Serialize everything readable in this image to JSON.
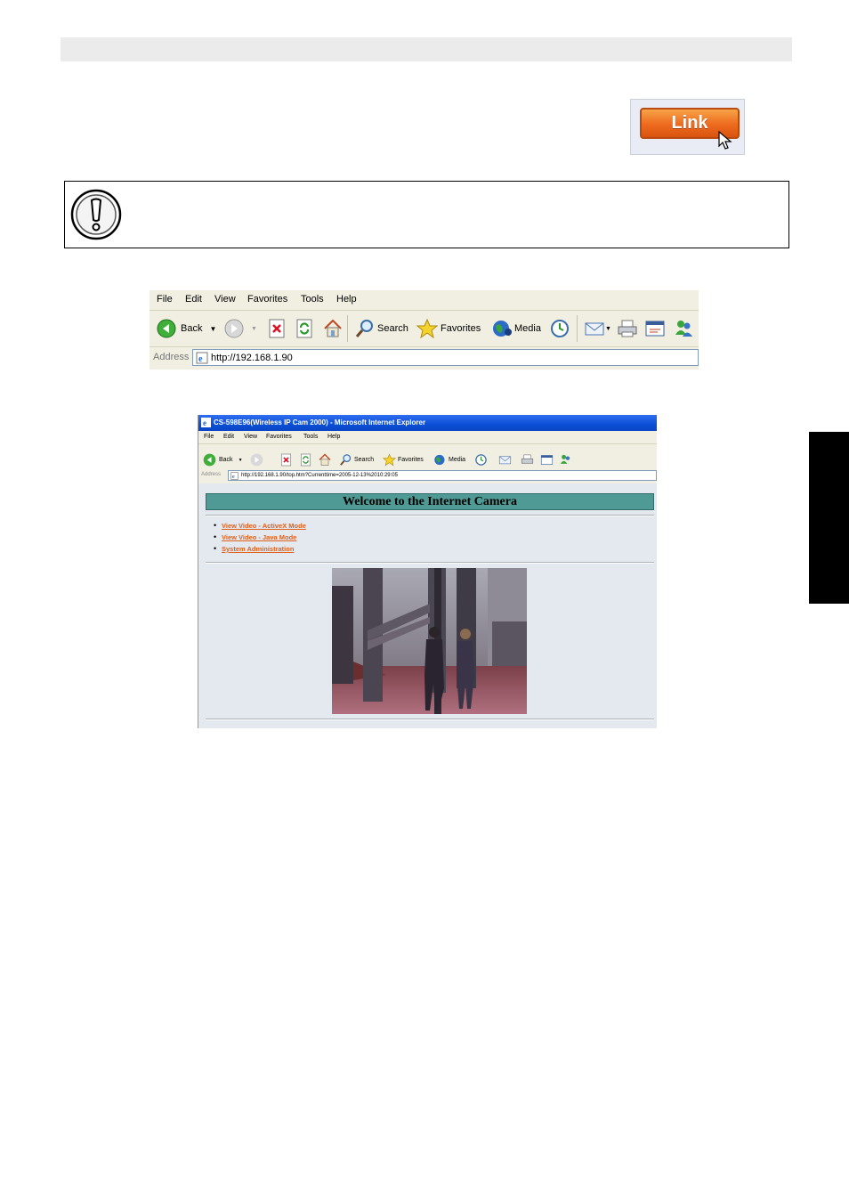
{
  "header_bar": "",
  "link_button": {
    "label": "Link"
  },
  "toolbar": {
    "menu": [
      "File",
      "Edit",
      "View",
      "Favorites",
      "Tools",
      "Help"
    ],
    "buttons": {
      "back": "Back",
      "search": "Search",
      "favorites": "Favorites",
      "media": "Media"
    },
    "address_label": "Address",
    "address_value": "http://192.168.1.90"
  },
  "browser": {
    "title": "CS-598E96(Wireless IP Cam 2000) - Microsoft Internet Explorer",
    "menu": [
      "File",
      "Edit",
      "View",
      "Favorites",
      "Tools",
      "Help"
    ],
    "buttons": {
      "back": "Back",
      "search": "Search",
      "favorites": "Favorites",
      "media": "Media"
    },
    "address_label": "Address",
    "address_value": "http://192.168.1.90/top.htm?Currenttime=2005-12-13%2010:29:05",
    "page": {
      "heading": "Welcome to the Internet Camera",
      "links": [
        "View Video - ActiveX Mode",
        "View Video - Java Mode",
        "System Administration"
      ]
    }
  },
  "colors": {
    "link_orange": "#ee6a1e",
    "heading_teal": "#4f9a94",
    "tab_black": "#000000"
  }
}
